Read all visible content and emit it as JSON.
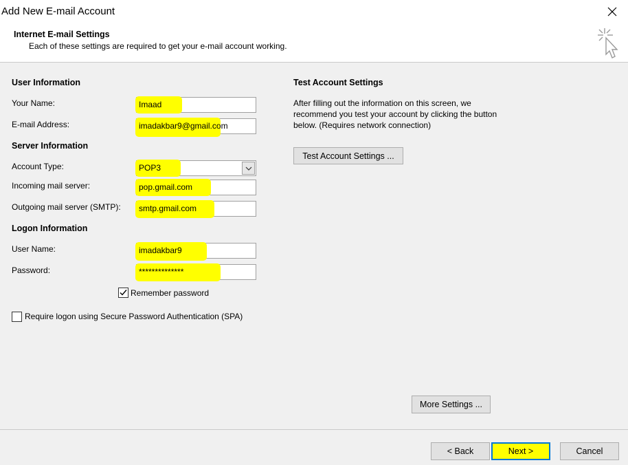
{
  "window": {
    "title": "Add New E-mail Account",
    "close_icon": "close-icon"
  },
  "header": {
    "title": "Internet E-mail Settings",
    "subtitle": "Each of these settings are required to get your e-mail account working.",
    "icon": "wizard-cursor-icon"
  },
  "user_info": {
    "heading": "User Information",
    "name_label": "Your Name:",
    "name_value": "Imaad",
    "email_label": "E-mail Address:",
    "email_value": "imadakbar9@gmail.com"
  },
  "server_info": {
    "heading": "Server Information",
    "account_type_label": "Account Type:",
    "account_type_value": "POP3",
    "incoming_label": "Incoming mail server:",
    "incoming_value": "pop.gmail.com",
    "outgoing_label": "Outgoing mail server (SMTP):",
    "outgoing_value": "smtp.gmail.com"
  },
  "logon_info": {
    "heading": "Logon Information",
    "username_label": "User Name:",
    "username_value": "imadakbar9",
    "password_label": "Password:",
    "password_value": "**************",
    "remember_label": "Remember password",
    "remember_checked": true,
    "spa_label": "Require logon using Secure Password Authentication (SPA)",
    "spa_checked": false
  },
  "test": {
    "heading": "Test Account Settings",
    "description": "After filling out the information on this screen, we recommend you test your account by clicking the button below. (Requires network connection)",
    "button": "Test Account Settings ..."
  },
  "buttons": {
    "more_settings": "More Settings ...",
    "back": "< Back",
    "next": "Next >",
    "cancel": "Cancel"
  },
  "colors": {
    "highlight": "#ffff00",
    "dialog_bg": "#f0f0f0",
    "button_bg": "#e1e1e1",
    "focus_border": "#0078d7"
  }
}
